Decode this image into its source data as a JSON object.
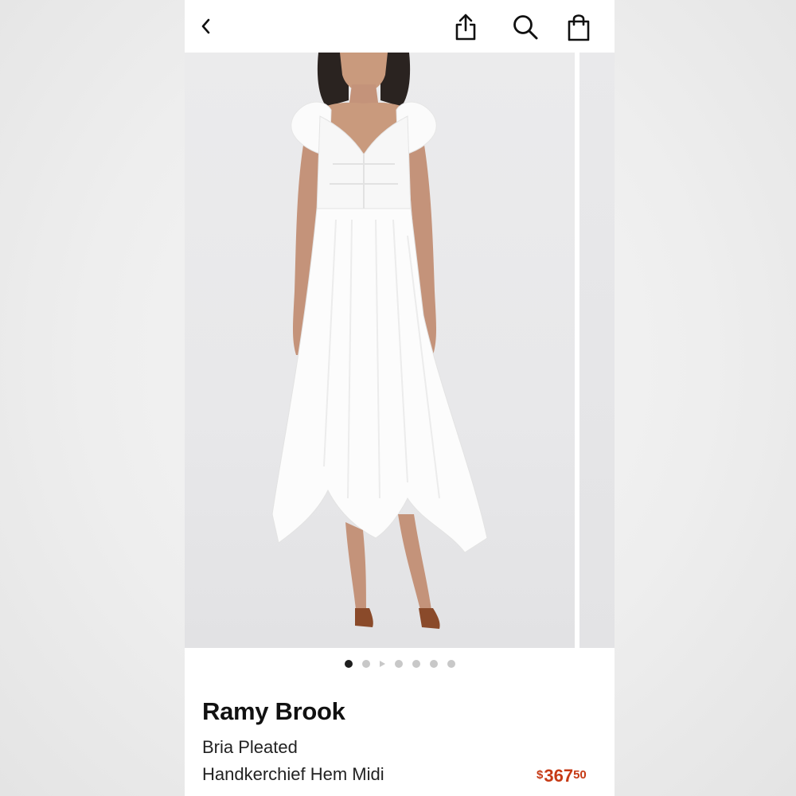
{
  "header": {
    "icons": [
      "back-chevron-icon",
      "share-icon",
      "search-icon",
      "shopping-bag-icon"
    ]
  },
  "gallery": {
    "image_alt": "White pleated handkerchief hem midi dress on model",
    "dots": {
      "count": 7,
      "active_index": 0,
      "video_index": 2
    }
  },
  "product": {
    "brand": "Ramy Brook",
    "name_line1": "Bria Pleated",
    "name_line2": "Handkerchief Hem Midi",
    "price": {
      "currency": "$",
      "whole": "367",
      "cents": "50",
      "color": "#c63a15"
    }
  }
}
